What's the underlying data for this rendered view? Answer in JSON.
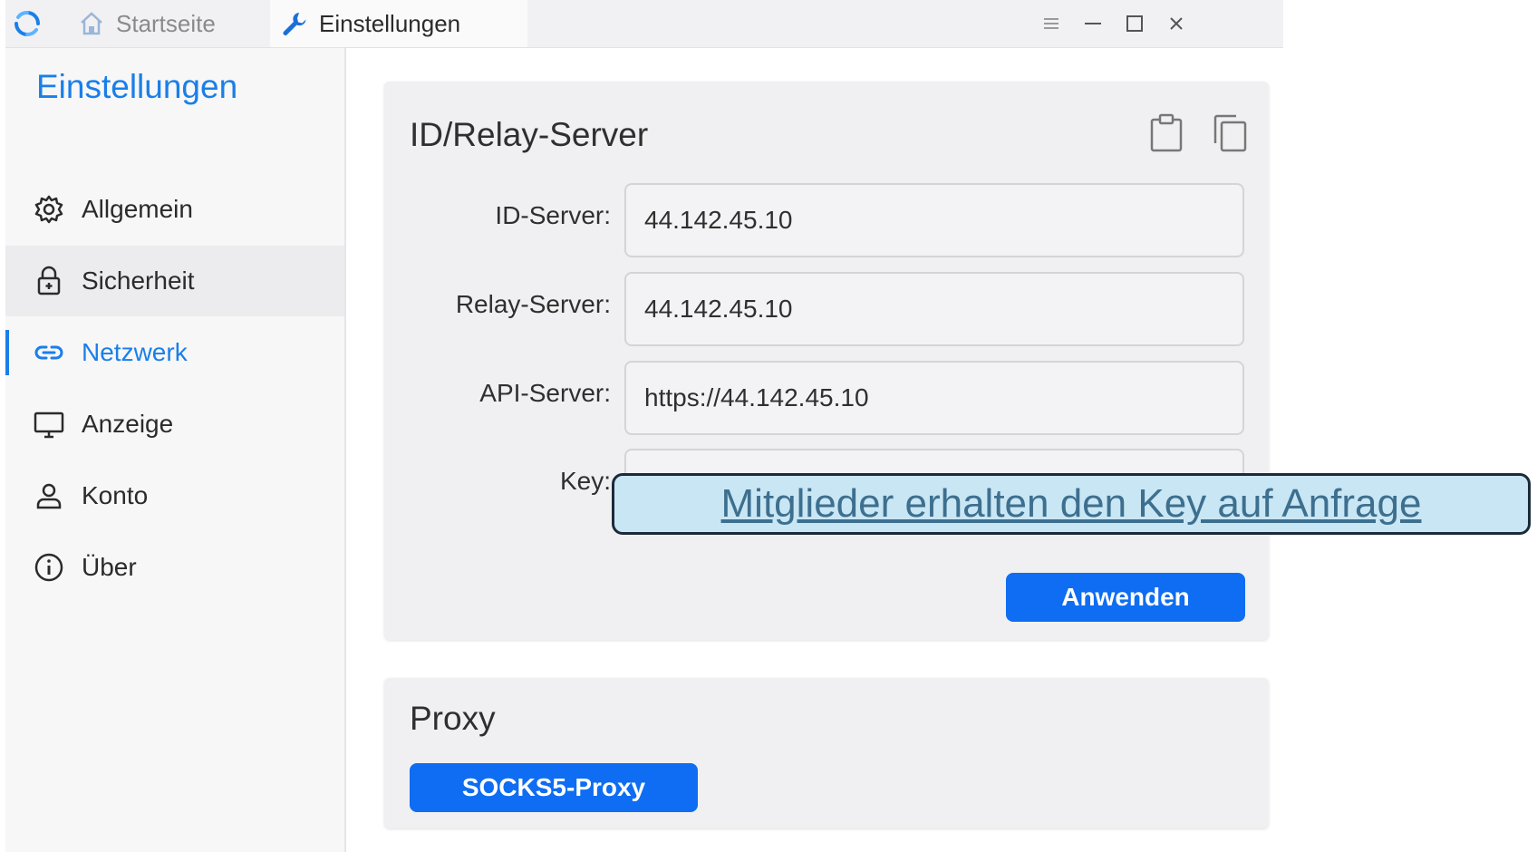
{
  "titlebar": {
    "tabs": [
      {
        "label": "Startseite",
        "icon": "home-icon"
      },
      {
        "label": "Einstellungen",
        "icon": "wrench-icon"
      }
    ],
    "controls": [
      "menu-icon",
      "minimize-icon",
      "maximize-icon",
      "close-icon"
    ]
  },
  "sidebar": {
    "title": "Einstellungen",
    "items": [
      {
        "label": "Allgemein",
        "icon": "gear-icon"
      },
      {
        "label": "Sicherheit",
        "icon": "lock-icon"
      },
      {
        "label": "Netzwerk",
        "icon": "link-icon",
        "active": true
      },
      {
        "label": "Anzeige",
        "icon": "monitor-icon"
      },
      {
        "label": "Konto",
        "icon": "user-icon"
      },
      {
        "label": "Über",
        "icon": "info-icon"
      }
    ]
  },
  "relay_card": {
    "title": "ID/Relay-Server",
    "fields": {
      "id_server": {
        "label": "ID-Server:",
        "value": "44.142.45.10"
      },
      "relay_server": {
        "label": "Relay-Server:",
        "value": "44.142.45.10"
      },
      "api_server": {
        "label": "API-Server:",
        "value": "https://44.142.45.10"
      },
      "key": {
        "label": "Key:",
        "value": ""
      }
    },
    "apply_label": "Anwenden"
  },
  "proxy_card": {
    "title": "Proxy",
    "socks_label": "SOCKS5-Proxy"
  },
  "overlay": {
    "link_text": "Mitglieder erhalten den Key auf Anfrage"
  },
  "colors": {
    "accent": "#1a7fe8",
    "button": "#0e6df2",
    "callout_bg": "#c9e6f4"
  }
}
